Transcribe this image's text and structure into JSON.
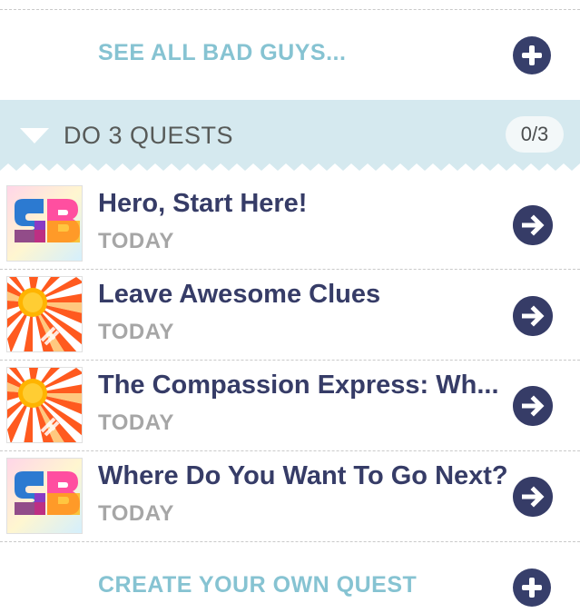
{
  "top_link": {
    "label": "SEE ALL BAD GUYS..."
  },
  "section": {
    "title": "DO 3 QUESTS",
    "progress": "0/3"
  },
  "quests": [
    {
      "title": "Hero, Start Here!",
      "date": "TODAY",
      "thumbnail": "superbetter-logo"
    },
    {
      "title": "Leave Awesome Clues",
      "date": "TODAY",
      "thumbnail": "sunburst"
    },
    {
      "title": "The Compassion Express: Wh...",
      "date": "TODAY",
      "thumbnail": "sunburst"
    },
    {
      "title": "Where Do You Want To Go Next?",
      "date": "TODAY",
      "thumbnail": "superbetter-logo"
    }
  ],
  "bottom_link": {
    "label": "CREATE YOUR OWN QUEST"
  },
  "colors": {
    "navy": "#363c67",
    "link_teal": "#86c3d2",
    "header_bg": "#d5e9ef",
    "date_gray": "#a6a6a6"
  }
}
